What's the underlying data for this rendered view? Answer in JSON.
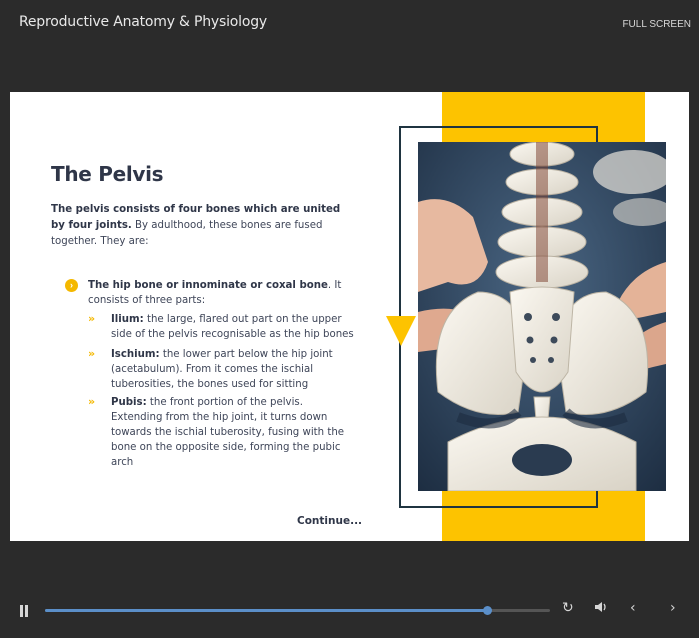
{
  "header": {
    "course_title": "Reproductive Anatomy & Physiology",
    "fullscreen_label": "FULL SCREEN"
  },
  "slide": {
    "heading": "The Pelvis",
    "intro_bold": "The pelvis consists of four bones which are united by four joints.",
    "intro_rest": " By adulthood, these bones are fused together. They are:",
    "bullet": {
      "bold": "The hip bone or innominate or coxal bone",
      "rest": ". It consists of three parts:"
    },
    "sub_items": [
      {
        "bold": "Ilium:",
        "rest": " the large, flared out part on the upper side of the pelvis recognisable as the hip bones"
      },
      {
        "bold": "Ischium:",
        "rest": " the lower part below the hip joint (acetabulum). From it comes the ischial tuberosities, the bones used for sitting"
      },
      {
        "bold": "Pubis:",
        "rest": " the front portion of the pelvis. Extending from the hip joint, it turns down towards the ischial tuberosity, fusing with the bone on the opposite side, forming the pubic arch"
      }
    ],
    "continue_label": "Continue...",
    "bullet_icon": "chevron-right-circle-icon",
    "sub_icon": "double-chevron-right-icon",
    "image": "pelvis-skeleton-model-photo"
  },
  "player": {
    "progress_fraction": 0.875,
    "icons": [
      "pause-icon",
      "replay-icon",
      "volume-icon",
      "previous-icon",
      "next-icon"
    ]
  },
  "colors": {
    "accent_yellow": "#fdc300",
    "frame_navy": "#1f3440",
    "heading": "#2f3648",
    "progress": "#5b8fc9",
    "background": "#2b2b2b"
  }
}
